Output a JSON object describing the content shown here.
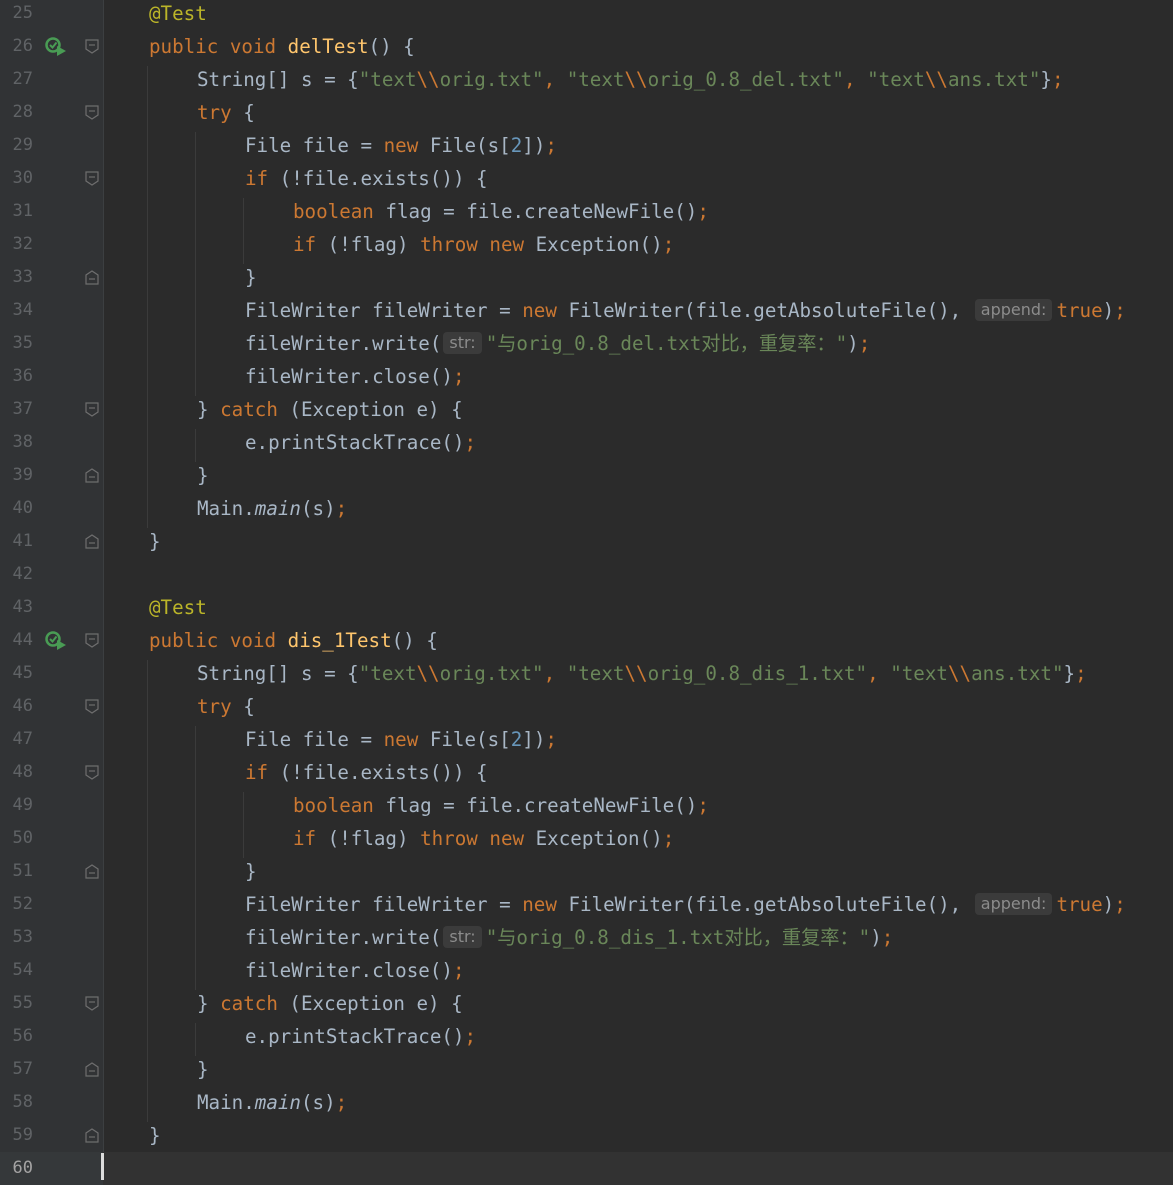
{
  "editor": {
    "colors": {
      "background": "#2b2b2b",
      "gutter": "#313335",
      "keyword": "#cc7832",
      "string": "#6a8759",
      "number": "#6897bb",
      "annotation": "#bbb529",
      "method_decl": "#ffc66d",
      "text": "#a9b7c6",
      "line_number": "#606366"
    },
    "current_line": "60",
    "hints": {
      "append": "append:",
      "str": "str:"
    },
    "lines": [
      {
        "n": "25",
        "icon": "",
        "fold": ""
      },
      {
        "n": "26",
        "icon": "run-test-icon",
        "fold": "fold-open-icon"
      },
      {
        "n": "27",
        "icon": "",
        "fold": ""
      },
      {
        "n": "28",
        "icon": "",
        "fold": "fold-open-icon"
      },
      {
        "n": "29",
        "icon": "",
        "fold": ""
      },
      {
        "n": "30",
        "icon": "",
        "fold": "fold-open-icon"
      },
      {
        "n": "31",
        "icon": "",
        "fold": ""
      },
      {
        "n": "32",
        "icon": "",
        "fold": ""
      },
      {
        "n": "33",
        "icon": "",
        "fold": "fold-close-icon"
      },
      {
        "n": "34",
        "icon": "",
        "fold": ""
      },
      {
        "n": "35",
        "icon": "",
        "fold": ""
      },
      {
        "n": "36",
        "icon": "",
        "fold": ""
      },
      {
        "n": "37",
        "icon": "",
        "fold": "fold-open-icon"
      },
      {
        "n": "38",
        "icon": "",
        "fold": ""
      },
      {
        "n": "39",
        "icon": "",
        "fold": "fold-close-icon"
      },
      {
        "n": "40",
        "icon": "",
        "fold": ""
      },
      {
        "n": "41",
        "icon": "",
        "fold": "fold-close-icon"
      },
      {
        "n": "42",
        "icon": "",
        "fold": ""
      },
      {
        "n": "43",
        "icon": "",
        "fold": ""
      },
      {
        "n": "44",
        "icon": "run-test-icon",
        "fold": "fold-open-icon"
      },
      {
        "n": "45",
        "icon": "",
        "fold": ""
      },
      {
        "n": "46",
        "icon": "",
        "fold": "fold-open-icon"
      },
      {
        "n": "47",
        "icon": "",
        "fold": ""
      },
      {
        "n": "48",
        "icon": "",
        "fold": "fold-open-icon"
      },
      {
        "n": "49",
        "icon": "",
        "fold": ""
      },
      {
        "n": "50",
        "icon": "",
        "fold": ""
      },
      {
        "n": "51",
        "icon": "",
        "fold": "fold-close-icon"
      },
      {
        "n": "52",
        "icon": "",
        "fold": ""
      },
      {
        "n": "53",
        "icon": "",
        "fold": ""
      },
      {
        "n": "54",
        "icon": "",
        "fold": ""
      },
      {
        "n": "55",
        "icon": "",
        "fold": "fold-open-icon"
      },
      {
        "n": "56",
        "icon": "",
        "fold": ""
      },
      {
        "n": "57",
        "icon": "",
        "fold": "fold-close-icon"
      },
      {
        "n": "58",
        "icon": "",
        "fold": ""
      },
      {
        "n": "59",
        "icon": "",
        "fold": "fold-close-icon"
      },
      {
        "n": "60",
        "icon": "",
        "fold": ""
      }
    ],
    "code": {
      "at_test": "@Test",
      "public": "public",
      "void": "void",
      "del_test": "delTest",
      "dis_test": "dis_1Test",
      "parens_brace": "() {",
      "string_arr": "String[] s = {",
      "s_orig": "\"text",
      "s_bs": "\\\\",
      "s_orig_tail": "orig.txt\"",
      "s_del_tail": "orig_0.8_del.txt\"",
      "s_dis_tail": "orig_0.8_dis_1.txt\"",
      "s_ans_tail": "ans.txt\"",
      "comma": ",",
      "close_brace_semi": "};",
      "try": "try",
      "open_brace": " {",
      "file_file_eq": "File file = ",
      "new": "new",
      "file_ctor": " File(s[",
      "two": "2",
      "file_ctor_end": "])",
      "semi": ";",
      "if": "if",
      "not_exists": " (!file.exists()) {",
      "boolean": "boolean",
      "flag_eq": " flag = file.createNewFile()",
      "not_flag": " (!flag) ",
      "throw": "throw",
      "exception_ctor": " Exception()",
      "close_brace": "}",
      "fw_decl": "FileWriter fileWriter = ",
      "fw_ctor": " FileWriter(file.getAbsoluteFile(),",
      "true": "true",
      "close_paren": ")",
      "fw_write": "fileWriter.write(",
      "del_msg": "\"与orig_0.8_del.txt对比，重复率：\"",
      "dis_msg": "\"与orig_0.8_dis_1.txt对比，重复率：\"",
      "fw_close": "fileWriter.close()",
      "catch_close": "} ",
      "catch": "catch",
      "catch_tail": " (Exception e) {",
      "print_stack": "e.printStackTrace()",
      "main_prefix": "Main.",
      "main_method": "main",
      "main_args": "(s)"
    }
  }
}
